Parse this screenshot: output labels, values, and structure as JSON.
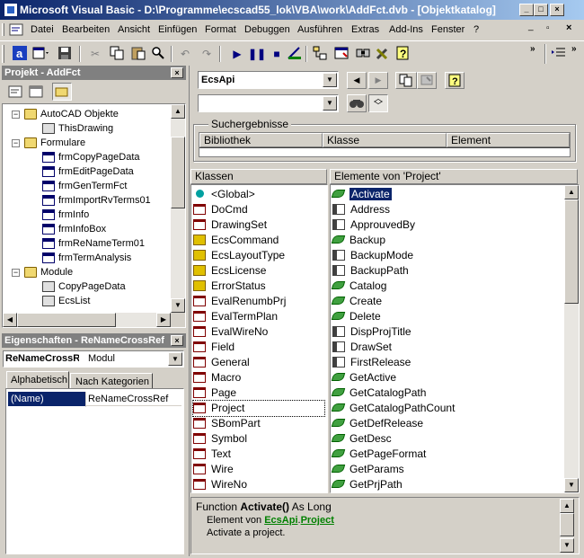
{
  "window": {
    "title": "Microsoft Visual Basic - D:\\Programme\\ecscad55_lok\\VBA\\work\\AddFct.dvb - [Objektkatalog]"
  },
  "menu": [
    "Datei",
    "Bearbeiten",
    "Ansicht",
    "Einfügen",
    "Format",
    "Debuggen",
    "Ausführen",
    "Extras",
    "Add-Ins",
    "Fenster",
    "?"
  ],
  "project_panel": {
    "title": "Projekt - AddFct",
    "tree": [
      {
        "label": "AutoCAD Objekte",
        "icon": "folder-icon"
      },
      {
        "label": "ThisDrawing",
        "icon": "drawing-icon"
      },
      {
        "label": "Formulare",
        "icon": "folder-icon"
      },
      {
        "label": "frmCopyPageData",
        "icon": "form-icon"
      },
      {
        "label": "frmEditPageData",
        "icon": "form-icon"
      },
      {
        "label": "frmGenTermFct",
        "icon": "form-icon"
      },
      {
        "label": "frmImportRvTerms01",
        "icon": "form-icon"
      },
      {
        "label": "frmInfo",
        "icon": "form-icon"
      },
      {
        "label": "frmInfoBox",
        "icon": "form-icon"
      },
      {
        "label": "frmReNameTerm01",
        "icon": "form-icon"
      },
      {
        "label": "frmTermAnalysis",
        "icon": "form-icon"
      },
      {
        "label": "Module",
        "icon": "folder-icon"
      },
      {
        "label": "CopyPageData",
        "icon": "module-icon"
      },
      {
        "label": "EcsList",
        "icon": "module-icon"
      }
    ]
  },
  "properties_panel": {
    "title": "Eigenschaften - ReNameCrossRef",
    "object_name": "ReNameCrossRef",
    "object_type": "Modul",
    "tabs": [
      "Alphabetisch",
      "Nach Kategorien"
    ],
    "rows": [
      {
        "name": "(Name)",
        "value": "ReNameCrossRef"
      }
    ]
  },
  "object_browser": {
    "library": "EcsApi",
    "search_text": "",
    "search_results_title": "Suchergebnisse",
    "search_columns": [
      "Bibliothek",
      "Klasse",
      "Element"
    ],
    "classes_header": "Klassen",
    "members_header": "Elemente von 'Project'",
    "classes": [
      {
        "label": "<Global>",
        "icon": "global"
      },
      {
        "label": "DoCmd",
        "icon": "class"
      },
      {
        "label": "DrawingSet",
        "icon": "class"
      },
      {
        "label": "EcsCommand",
        "icon": "enum"
      },
      {
        "label": "EcsLayoutType",
        "icon": "enum"
      },
      {
        "label": "EcsLicense",
        "icon": "enum"
      },
      {
        "label": "ErrorStatus",
        "icon": "enum"
      },
      {
        "label": "EvalRenumbPrj",
        "icon": "class"
      },
      {
        "label": "EvalTermPlan",
        "icon": "class"
      },
      {
        "label": "EvalWireNo",
        "icon": "class"
      },
      {
        "label": "Field",
        "icon": "class"
      },
      {
        "label": "General",
        "icon": "class"
      },
      {
        "label": "Macro",
        "icon": "class"
      },
      {
        "label": "Page",
        "icon": "class"
      },
      {
        "label": "Project",
        "icon": "class"
      },
      {
        "label": "SBomPart",
        "icon": "class"
      },
      {
        "label": "Symbol",
        "icon": "class"
      },
      {
        "label": "Text",
        "icon": "class"
      },
      {
        "label": "Wire",
        "icon": "class"
      },
      {
        "label": "WireNo",
        "icon": "class"
      }
    ],
    "selected_class": "Project",
    "members": [
      {
        "label": "Activate",
        "icon": "method"
      },
      {
        "label": "Address",
        "icon": "prop"
      },
      {
        "label": "ApprouvedBy",
        "icon": "prop"
      },
      {
        "label": "Backup",
        "icon": "method"
      },
      {
        "label": "BackupMode",
        "icon": "prop"
      },
      {
        "label": "BackupPath",
        "icon": "prop"
      },
      {
        "label": "Catalog",
        "icon": "method"
      },
      {
        "label": "Create",
        "icon": "method"
      },
      {
        "label": "Delete",
        "icon": "method"
      },
      {
        "label": "DispProjTitle",
        "icon": "prop"
      },
      {
        "label": "DrawSet",
        "icon": "prop"
      },
      {
        "label": "FirstRelease",
        "icon": "prop"
      },
      {
        "label": "GetActive",
        "icon": "method"
      },
      {
        "label": "GetCatalogPath",
        "icon": "method"
      },
      {
        "label": "GetCatalogPathCount",
        "icon": "method"
      },
      {
        "label": "GetDefRelease",
        "icon": "method"
      },
      {
        "label": "GetDesc",
        "icon": "method"
      },
      {
        "label": "GetPageFormat",
        "icon": "method"
      },
      {
        "label": "GetParams",
        "icon": "method"
      },
      {
        "label": "GetPrjPath",
        "icon": "method"
      }
    ],
    "selected_member": "Activate",
    "details": {
      "signature_prefix": "Function ",
      "signature_name": "Activate()",
      "signature_suffix": " As Long",
      "member_of_label": "Element von ",
      "member_of_lib": "EcsApi",
      "member_of_sep": ".",
      "member_of_class": "Project",
      "description": "Activate a project."
    }
  },
  "colors": {
    "title_active": "#0a246a",
    "selection": "#0a246a",
    "link": "#008000"
  }
}
